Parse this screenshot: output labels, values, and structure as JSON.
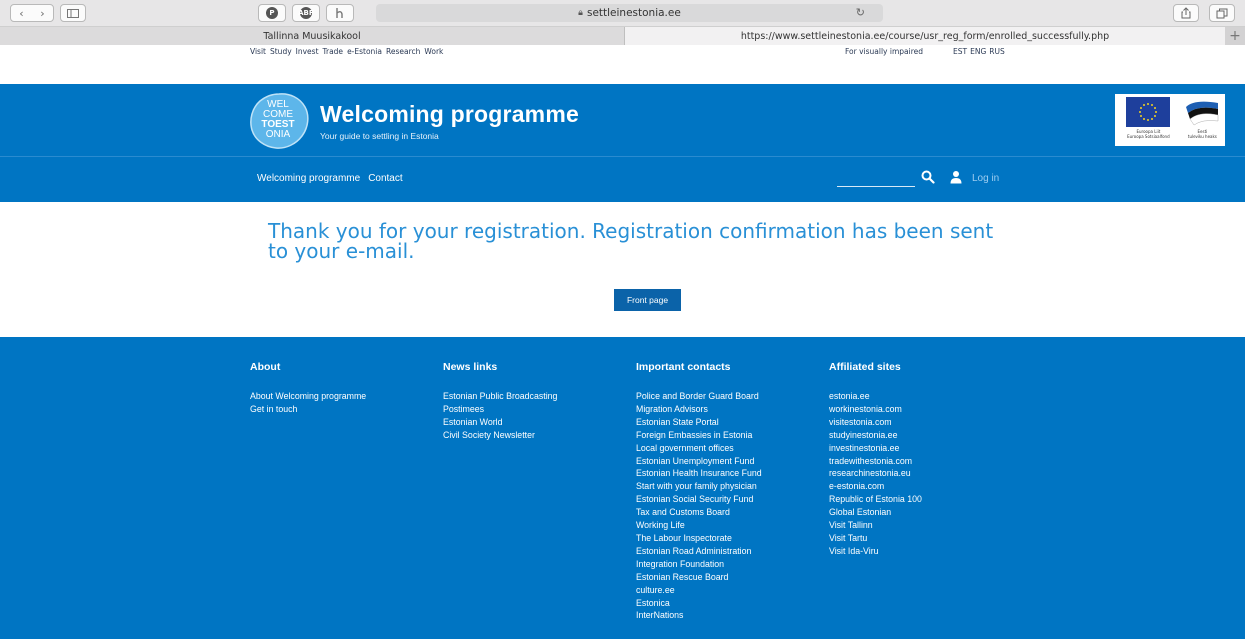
{
  "browser": {
    "url_display": "settleinestonia.ee",
    "tabs": [
      {
        "label": "Tallinna Muusikakool"
      },
      {
        "label": "https://www.settleinestonia.ee/course/usr_reg_form/enrolled_successfully.php"
      }
    ],
    "new_tab_symbol": "+"
  },
  "toplinks": {
    "left": [
      "Visit",
      "Study",
      "Invest",
      "Trade",
      "e-Estonia",
      "Research",
      "Work"
    ],
    "visually_impaired": "For visually impaired",
    "languages": [
      "EST",
      "ENG",
      "RUS"
    ]
  },
  "header": {
    "logo_lines": [
      "WEL",
      "COME",
      "TOEST",
      "ONIA"
    ],
    "title": "Welcoming programme",
    "subtitle": "Your guide to settling in Estonia",
    "eu_caption": [
      "Euroopa Liit",
      "Euroopa Sotsiaalfond"
    ],
    "ee_caption": [
      "Eesti",
      "tuleviku heaks"
    ],
    "nav": [
      "Welcoming programme",
      "Contact"
    ],
    "login_label": "Log in"
  },
  "main": {
    "message": "Thank you for your registration. Registration confirmation has been sent to your e-mail.",
    "front_page_button": "Front page"
  },
  "footer": {
    "columns": [
      {
        "title": "About",
        "links": [
          "About Welcoming programme",
          "Get in touch"
        ]
      },
      {
        "title": "News links",
        "links": [
          "Estonian Public Broadcasting",
          "Postimees",
          "Estonian World",
          "Civil Society Newsletter"
        ]
      },
      {
        "title": "Important contacts",
        "links": [
          "Police and Border Guard Board",
          "Migration Advisors",
          "Estonian State Portal",
          "Foreign Embassies in Estonia",
          "Local government offices",
          "Estonian Unemployment Fund",
          "Estonian Health Insurance Fund",
          "Start with your family physician",
          "Estonian Social Security Fund",
          "Tax and Customs Board",
          "Working Life",
          "The Labour Inspectorate",
          "Estonian Road Administration",
          "Integration Foundation",
          "Estonian Rescue Board",
          "culture.ee",
          "Estonica",
          "InterNations"
        ]
      },
      {
        "title": "Affiliated sites",
        "links": [
          "estonia.ee",
          "workinestonia.com",
          "visitestonia.com",
          "studyinestonia.ee",
          "investinestonia.ee",
          "tradewithestonia.com",
          "researchinestonia.eu",
          "e-estonia.com",
          "Republic of Estonia 100",
          "Global Estonian",
          "Visit Tallinn",
          "Visit Tartu",
          "Visit Ida-Viru"
        ]
      }
    ]
  },
  "colors": {
    "brand_blue": "#0075c3",
    "message_blue": "#2990d6",
    "button_blue": "#0b63a9"
  }
}
